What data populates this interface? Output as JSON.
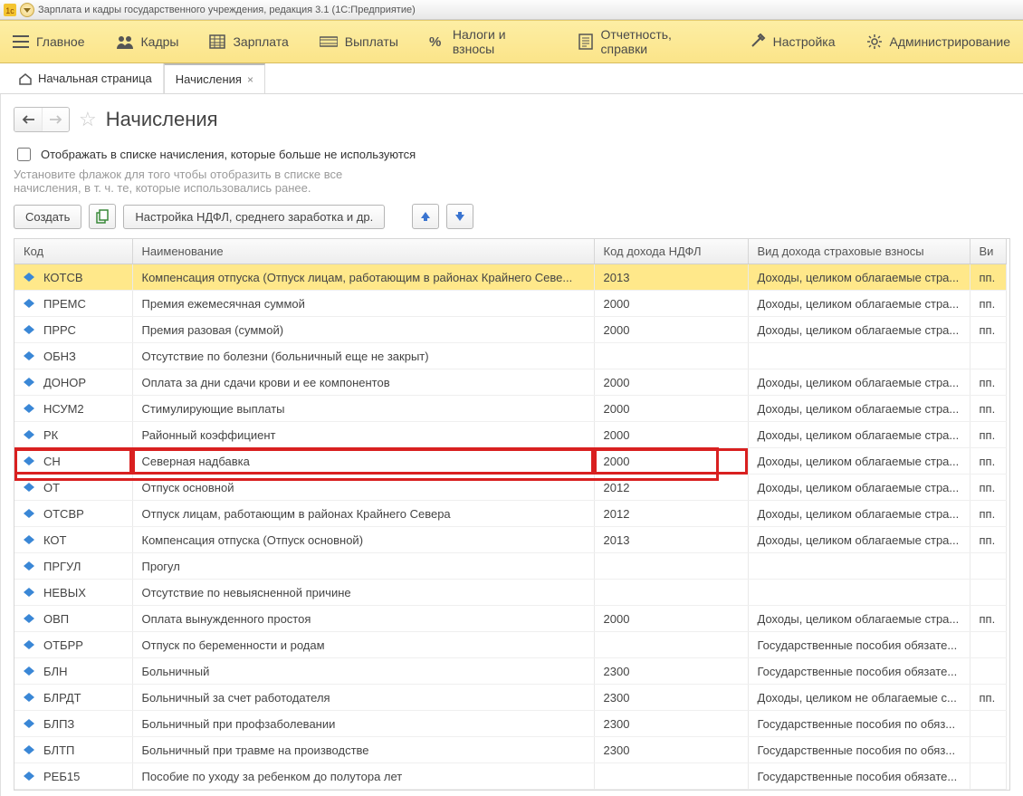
{
  "window": {
    "title": "Зарплата и кадры государственного учреждения, редакция 3.1  (1С:Предприятие)"
  },
  "menu": {
    "main": "Главное",
    "staff": "Кадры",
    "salary": "Зарплата",
    "pay": "Выплаты",
    "tax": "Налоги и взносы",
    "rep": "Отчетность, справки",
    "set": "Настройка",
    "admin": "Администрирование"
  },
  "tabs": {
    "home": "Начальная страница",
    "accruals": "Начисления"
  },
  "page": {
    "title": "Начисления",
    "checkbox": "Отображать в списке начисления, которые больше не используются",
    "hint": "Установите флажок для того чтобы отобразить в списке все\nначисления, в т. ч. те, которые использовались ранее.",
    "create": "Создать",
    "config": "Настройка НДФЛ, среднего заработка и др."
  },
  "columns": {
    "code": "Код",
    "name": "Наименование",
    "ndfl": "Код дохода НДФЛ",
    "ins": "Вид дохода страховые взносы",
    "last": "Ви"
  },
  "rows": [
    {
      "code": "КОТСВ",
      "name": "Компенсация отпуска (Отпуск лицам, работающим в районах Крайнего Севе...",
      "ndfl": "2013",
      "ins": "Доходы, целиком облагаемые стра...",
      "last": "пп.",
      "selected": true
    },
    {
      "code": "ПРЕМС",
      "name": "Премия ежемесячная суммой",
      "ndfl": "2000",
      "ins": "Доходы, целиком облагаемые стра...",
      "last": "пп."
    },
    {
      "code": "ПРРС",
      "name": "Премия разовая (суммой)",
      "ndfl": "2000",
      "ins": "Доходы, целиком облагаемые стра...",
      "last": "пп."
    },
    {
      "code": "ОБНЗ",
      "name": "Отсутствие по болезни (больничный еще не закрыт)",
      "ndfl": "",
      "ins": "",
      "last": ""
    },
    {
      "code": "ДОНОР",
      "name": "Оплата за дни сдачи крови и ее компонентов",
      "ndfl": "2000",
      "ins": "Доходы, целиком облагаемые стра...",
      "last": "пп."
    },
    {
      "code": "НСУМ2",
      "name": "Стимулирующие выплаты",
      "ndfl": "2000",
      "ins": "Доходы, целиком облагаемые стра...",
      "last": "пп."
    },
    {
      "code": "РК",
      "name": "Районный коэффициент",
      "ndfl": "2000",
      "ins": "Доходы, целиком облагаемые стра...",
      "last": "пп."
    },
    {
      "code": "СН",
      "name": "Северная надбавка",
      "ndfl": "2000",
      "ins": "Доходы, целиком облагаемые стра...",
      "last": "пп.",
      "highlight": true
    },
    {
      "code": "ОТ",
      "name": "Отпуск основной",
      "ndfl": "2012",
      "ins": "Доходы, целиком облагаемые стра...",
      "last": "пп."
    },
    {
      "code": "ОТСВР",
      "name": "Отпуск лицам, работающим в районах Крайнего Севера",
      "ndfl": "2012",
      "ins": "Доходы, целиком облагаемые стра...",
      "last": "пп."
    },
    {
      "code": "КОТ",
      "name": "Компенсация отпуска (Отпуск основной)",
      "ndfl": "2013",
      "ins": "Доходы, целиком облагаемые стра...",
      "last": "пп."
    },
    {
      "code": "ПРГУЛ",
      "name": "Прогул",
      "ndfl": "",
      "ins": "",
      "last": ""
    },
    {
      "code": "НЕВЫХ",
      "name": "Отсутствие по невыясненной причине",
      "ndfl": "",
      "ins": "",
      "last": ""
    },
    {
      "code": "ОВП",
      "name": "Оплата вынужденного простоя",
      "ndfl": "2000",
      "ins": "Доходы, целиком облагаемые стра...",
      "last": "пп."
    },
    {
      "code": "ОТБРР",
      "name": "Отпуск по беременности и родам",
      "ndfl": "",
      "ins": "Государственные пособия обязате...",
      "last": ""
    },
    {
      "code": "БЛН",
      "name": "Больничный",
      "ndfl": "2300",
      "ins": "Государственные пособия обязате...",
      "last": ""
    },
    {
      "code": "БЛРДТ",
      "name": "Больничный за счет работодателя",
      "ndfl": "2300",
      "ins": "Доходы, целиком не облагаемые с...",
      "last": "пп."
    },
    {
      "code": "БЛПЗ",
      "name": "Больничный при профзаболевании",
      "ndfl": "2300",
      "ins": "Государственные пособия по обяз...",
      "last": ""
    },
    {
      "code": "БЛТП",
      "name": "Больничный при травме на производстве",
      "ndfl": "2300",
      "ins": "Государственные пособия по обяз...",
      "last": ""
    },
    {
      "code": "РЕБ15",
      "name": "Пособие по уходу за ребенком до полутора лет",
      "ndfl": "",
      "ins": "Государственные пособия обязате...",
      "last": ""
    }
  ]
}
